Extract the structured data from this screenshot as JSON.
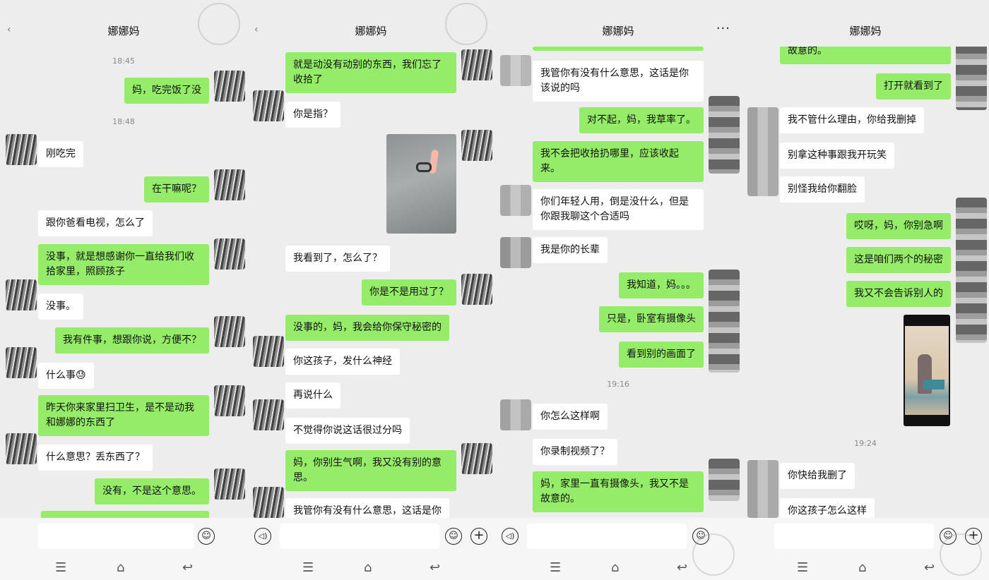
{
  "panels": [
    {
      "title": "娜娜妈",
      "back_icon": "‹",
      "timestamps": [
        "18:45",
        "18:48"
      ],
      "messages": [
        {
          "side": "out",
          "text": "妈，吃完饭了没"
        },
        {
          "side": "in",
          "text": "刚吃完"
        },
        {
          "side": "out",
          "text": "在干嘛呢？"
        },
        {
          "side": "in",
          "text": "跟你爸看电视，怎么了"
        },
        {
          "side": "out",
          "text": "没事，就是想感谢你一直给我们收拾家里，照顾孩子"
        },
        {
          "side": "in",
          "text": "没事。"
        },
        {
          "side": "out",
          "text": "我有件事，想跟你说，方便不？"
        },
        {
          "side": "in",
          "text": "什么事😓"
        },
        {
          "side": "out",
          "text": "昨天你来家里扫卫生，是不是动我和娜娜的东西了"
        },
        {
          "side": "in",
          "text": "什么意思？丢东西了？"
        },
        {
          "side": "out",
          "text": "没有，不是这个意思。"
        }
      ]
    },
    {
      "title": "娜娜妈",
      "back_icon": "‹",
      "messages": [
        {
          "side": "out",
          "text": "就是动没有动别的东西，我们忘了收拾了"
        },
        {
          "side": "in",
          "text": "你是指？"
        },
        {
          "side": "in",
          "text": "我看到了，怎么了？"
        },
        {
          "side": "out",
          "text": "你是不是用过了？"
        },
        {
          "side": "out",
          "text": "没事的，妈，我会给你保守秘密的"
        },
        {
          "side": "in",
          "text": "你这孩子，发什么神经"
        },
        {
          "side": "in",
          "text": "再说什么"
        },
        {
          "side": "in",
          "text": "不觉得你说这话很过分吗"
        },
        {
          "side": "out",
          "text": "妈，你别生气啊，我又没有别的意思。"
        },
        {
          "side": "in",
          "text": "我管你有没有什么意思，这话是你"
        }
      ]
    },
    {
      "title": "娜娜妈",
      "more_icon": "···",
      "timestamps": [
        "19:16"
      ],
      "messages": [
        {
          "side": "in",
          "text": "我管你有没有什么意思，这话是你该说的吗"
        },
        {
          "side": "out",
          "text": "对不起，妈，我草率了。"
        },
        {
          "side": "out",
          "text": "我不会把收拾扔哪里，应该收起来。"
        },
        {
          "side": "in",
          "text": "你们年轻人用，倒是没什么，但是你跟我聊这个合适吗"
        },
        {
          "side": "in",
          "text": "我是你的长辈"
        },
        {
          "side": "out",
          "text": "我知道，妈。。。"
        },
        {
          "side": "out",
          "text": "只是，卧室有摄像头"
        },
        {
          "side": "out",
          "text": "看到别的画面了"
        },
        {
          "side": "in",
          "text": "你怎么这样啊"
        },
        {
          "side": "in",
          "text": "你录制视频了？"
        },
        {
          "side": "out",
          "text": "妈，家里一直有摄像头，我又不是故意的。"
        }
      ]
    },
    {
      "title": "娜娜妈",
      "timestamps": [
        "19:24"
      ],
      "messages": [
        {
          "side": "out",
          "text": "故意的。"
        },
        {
          "side": "out",
          "text": "打开就看到了"
        },
        {
          "side": "in",
          "text": "我不管什么理由，你给我删掉"
        },
        {
          "side": "in",
          "text": "别拿这种事跟我开玩笑"
        },
        {
          "side": "in",
          "text": "别怪我给你翻脸"
        },
        {
          "side": "out",
          "text": "哎呀，妈，你别急啊"
        },
        {
          "side": "out",
          "text": "这是咱们两个的秘密"
        },
        {
          "side": "out",
          "text": "我又不会告诉别人的"
        },
        {
          "side": "in",
          "text": "你快给我删了"
        },
        {
          "side": "in",
          "text": "你这孩子怎么这样"
        }
      ]
    }
  ],
  "icons": {
    "voice": "◁)",
    "emoji": "☺",
    "plus": "+",
    "nav_menu": "☰",
    "nav_home": "⌂",
    "nav_back": "↩"
  }
}
